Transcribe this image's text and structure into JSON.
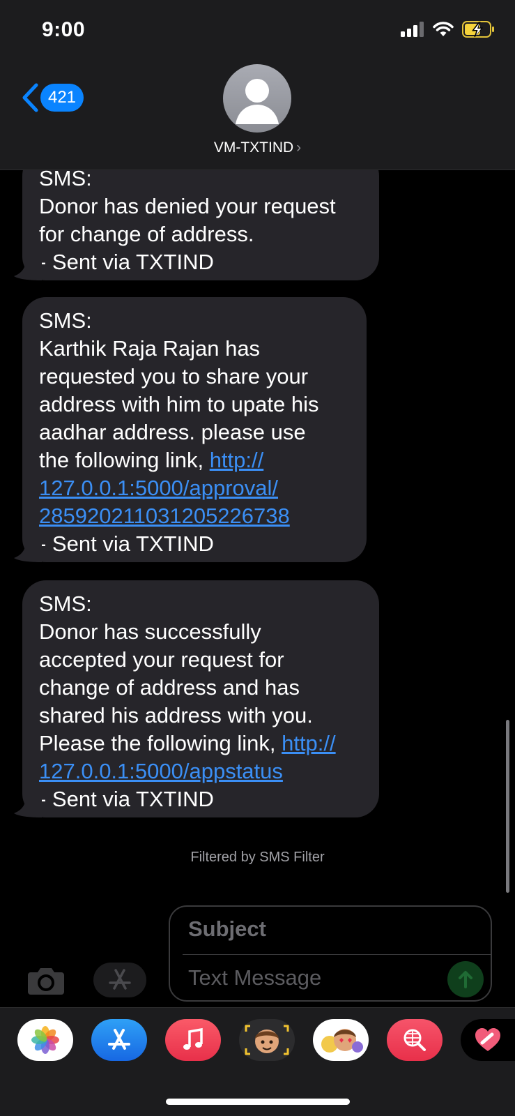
{
  "status_bar": {
    "time": "9:00"
  },
  "nav": {
    "back_count": "421",
    "contact_name": "VM-TXTIND",
    "contact_chevron": "›"
  },
  "messages": [
    {
      "header": "SMS:",
      "lines": [
        "Donor has denied your request",
        "for change of address."
      ],
      "footer": "- Sent via TXTIND"
    },
    {
      "header": "SMS:",
      "lines": [
        "Karthik Raja Rajan has",
        "requested you to share your",
        "address with him to upate his",
        "aadhar address. please use"
      ],
      "link_prefix": "the following link, ",
      "link_lines": [
        "http://",
        "127.0.0.1:5000/approval/",
        "28592021103120522673​8"
      ],
      "footer": "- Sent via TXTIND"
    },
    {
      "header": "SMS:",
      "lines": [
        "Donor has successfully",
        "accepted your request for",
        "change of address and has",
        "shared his address with you."
      ],
      "link_prefix": "Please the following link, ",
      "link_lines": [
        "http://",
        "127.0.0.1:5000/appstatus"
      ],
      "footer": "- Sent via TXTIND"
    }
  ],
  "filter_note": "Filtered by SMS Filter",
  "compose": {
    "subject_placeholder": "Subject",
    "message_placeholder": "Text Message"
  },
  "app_drawer": [
    "photos-app",
    "app-store-app",
    "music-app",
    "memoji-app",
    "memoji-stickers-app",
    "search-images-app",
    "digital-touch-app"
  ],
  "colors": {
    "bubble": "#26252a",
    "link": "#3b8ff5",
    "accent": "#0a84ff"
  }
}
